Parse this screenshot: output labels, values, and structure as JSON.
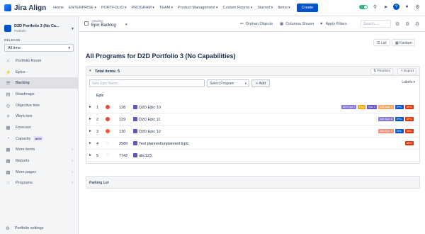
{
  "nav": {
    "logo": "Jira Align",
    "items": [
      "Home",
      "ENTERPRISE",
      "PORTFOLIO",
      "PROGRAM",
      "TEAM",
      "Product Management",
      "Custom Rooms",
      "Starred",
      "Items"
    ],
    "create": "Create"
  },
  "sidebar": {
    "portfolio_name": "D2D Portfolio 3 (No Ca...",
    "portfolio_type": "Portfolio",
    "release_label": "RELEASE",
    "release_value": "All time",
    "items": [
      {
        "label": "Portfolio Room",
        "icon": "home-icon"
      },
      {
        "label": "Epics",
        "icon": "epic-icon"
      },
      {
        "label": "Backlog",
        "icon": "backlog-icon"
      },
      {
        "label": "Roadmaps",
        "icon": "roadmap-icon"
      },
      {
        "label": "Objective tree",
        "icon": "objective-icon"
      },
      {
        "label": "Work tree",
        "icon": "tree-icon"
      },
      {
        "label": "Forecast",
        "icon": "forecast-icon"
      },
      {
        "label": "Capacity",
        "icon": "capacity-icon",
        "badge": "NEW"
      },
      {
        "label": "More items",
        "icon": "list-icon"
      },
      {
        "label": "Reports",
        "icon": "report-icon"
      },
      {
        "label": "More pages",
        "icon": "pages-icon"
      },
      {
        "label": "Programs",
        "icon": "programs-icon"
      }
    ],
    "footer": "Portfolio settings"
  },
  "subheader": {
    "viewing_label": "Viewing:",
    "viewing_value": "Epic Backlog",
    "orphan": "Orphan Objects",
    "columns": "Columns Shown",
    "filters": "Apply Filters",
    "search_placeholder": "Search..."
  },
  "content": {
    "list_label": "List",
    "kanban_label": "Kanban",
    "title": "All Programs for D2D Portfolio 3 (No Capabilities)",
    "total": "Total items: 5",
    "prioritize": "Prioritize",
    "export": "Export",
    "new_epic_placeholder": "New Epic Name...",
    "select_program": "Select Program",
    "add": "Add",
    "labels": "Labels",
    "col_epic": "Epic",
    "parking": "Parking Lot"
  },
  "rows": [
    {
      "num": "1",
      "id": "128",
      "name": "D2D Epic 10",
      "status": "#e5493a",
      "tags": [
        [
          "D2D Epic 7",
          "#8777d9"
        ],
        [
          "Epic",
          "#ffab00"
        ],
        [
          "Epic 2",
          "#6554c0"
        ],
        [
          "D2D Epic 5",
          "#f6a962"
        ],
        [
          "EPIC",
          "#0052cc"
        ],
        [
          "APIC",
          "#de350b"
        ]
      ]
    },
    {
      "num": "2",
      "id": "129",
      "name": "D2D Epic 11",
      "status": "#e5493a",
      "tags": [
        [
          "D2D Epic 5",
          "#8777d9"
        ],
        [
          "EPIC",
          "#0052cc"
        ],
        [
          "APIC",
          "#de350b"
        ]
      ]
    },
    {
      "num": "3",
      "id": "130",
      "name": "D2D Epic 12",
      "status": "#ff5630",
      "tags": [
        [
          "D2D Epic 5",
          "#f08f7a"
        ],
        [
          "EPIC",
          "#0052cc"
        ],
        [
          "APIC",
          "#de350b"
        ]
      ]
    },
    {
      "num": "4",
      "id": "2589",
      "name": "Test planned/unplanned Epic",
      "status": "star",
      "tags": [
        [
          "APIC",
          "#de350b"
        ]
      ]
    },
    {
      "num": "5",
      "id": "7742",
      "name": "abc123",
      "status": "star",
      "tags": []
    }
  ]
}
